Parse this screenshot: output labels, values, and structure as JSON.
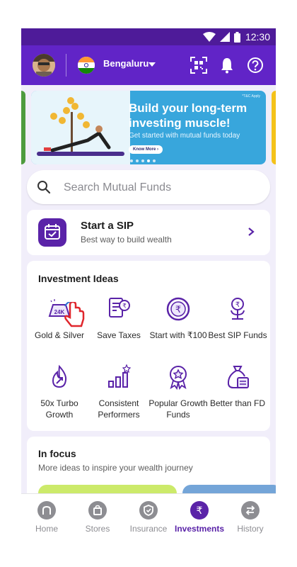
{
  "status_bar": {
    "time": "12:30"
  },
  "header": {
    "city": "Bengaluru"
  },
  "banner": {
    "title_line1": "Build your long-term",
    "title_line2": "investing muscle!",
    "subtitle": "Get started with mutual funds today",
    "button_label": "Know More",
    "tc_label": "*T&C Apply"
  },
  "search": {
    "placeholder": "Search Mutual Funds"
  },
  "sip_card": {
    "title": "Start a SIP",
    "subtitle": "Best way to build wealth"
  },
  "investment_ideas": {
    "heading": "Investment Ideas",
    "items": [
      {
        "label": "Gold & Silver",
        "icon": "gold-bar-icon"
      },
      {
        "label": "Save Taxes",
        "icon": "tax-receipt-icon"
      },
      {
        "label": "Start with ₹100",
        "icon": "rupee-coin-icon"
      },
      {
        "label": "Best SIP Funds",
        "icon": "rupee-plant-icon"
      },
      {
        "label": "50x Turbo Growth",
        "icon": "flame-arrow-icon"
      },
      {
        "label": "Consistent Performers",
        "icon": "bar-chart-star-icon"
      },
      {
        "label": "Popular Growth Funds",
        "icon": "star-badge-icon"
      },
      {
        "label": "Better than FD",
        "icon": "money-bag-icon"
      }
    ]
  },
  "in_focus": {
    "heading": "In focus",
    "subtitle": "More ideas to inspire your wealth journey"
  },
  "bottom_nav": {
    "items": [
      {
        "label": "Home",
        "icon": "home-icon"
      },
      {
        "label": "Stores",
        "icon": "shopping-bag-icon"
      },
      {
        "label": "Insurance",
        "icon": "shield-icon"
      },
      {
        "label": "Investments",
        "icon": "rupee-icon",
        "active": true
      },
      {
        "label": "History",
        "icon": "transfer-arrows-icon"
      }
    ]
  },
  "colors": {
    "brand_purple": "#6124c7",
    "status_purple": "#4e1b99",
    "banner_blue": "#38a6dc",
    "active_tab": "#5a23a8"
  }
}
